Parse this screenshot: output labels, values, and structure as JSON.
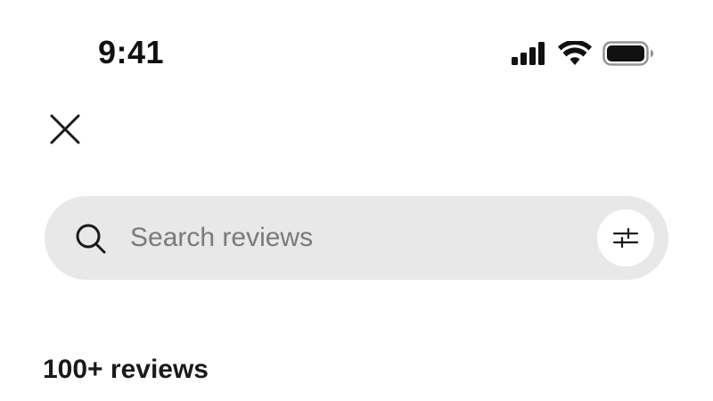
{
  "status_bar": {
    "time": "9:41",
    "icons": [
      "cellular-signal-icon",
      "wifi-icon",
      "battery-icon"
    ]
  },
  "header": {
    "close_icon": "close-icon"
  },
  "search": {
    "placeholder": "Search reviews",
    "value": "",
    "search_icon": "search-icon",
    "filter_icon": "filter-sliders-icon"
  },
  "reviews": {
    "count_label": "100+ reviews"
  },
  "colors": {
    "background": "#ffffff",
    "search_bar_bg": "#e8e8e8",
    "text_primary": "#1a1a1a",
    "placeholder": "#7a7a7a"
  }
}
